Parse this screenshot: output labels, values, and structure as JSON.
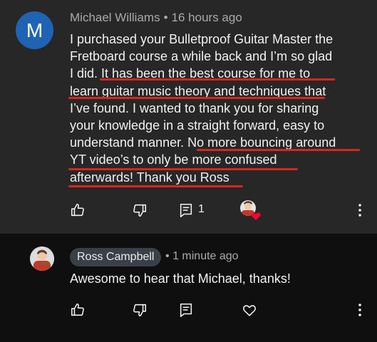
{
  "comment": {
    "avatar_letter": "M",
    "author": "Michael Williams",
    "separator": "•",
    "time": "16 hours ago",
    "body_lines": [
      "I purchased your Bulletproof Guitar Master the",
      "Fretboard course a while back and I’m so glad",
      "I did. It has been the best course for me to",
      "learn guitar music theory and techniques that",
      "I’ve found. I wanted to thank you for sharing",
      "your knowledge in a straight forward, easy to",
      "understand manner. No more bouncing around",
      "YT video’s to only be more confused",
      "afterwards! Thank you Ross"
    ],
    "reply_count": "1",
    "actions": {
      "like_icon": "thumbs-up-icon",
      "dislike_icon": "thumbs-down-icon",
      "reply_icon": "reply-comment-icon",
      "heart_icon": "creator-heart-icon",
      "more_icon": "more-vertical-icon"
    }
  },
  "reply": {
    "author": "Ross Campbell",
    "separator": "•",
    "time": "1 minute ago",
    "body": "Awesome to hear that Michael, thanks!",
    "actions": {
      "like_icon": "thumbs-up-icon",
      "dislike_icon": "thumbs-down-icon",
      "reply_icon": "reply-comment-icon",
      "heart_icon": "heart-outline-icon",
      "more_icon": "more-vertical-icon"
    }
  },
  "colors": {
    "comment_bg": "#272727",
    "reply_bg": "#0f0f0f",
    "avatar_blue": "#1e63b4",
    "underline_red": "#d7261e",
    "heart_red": "#ff0033",
    "text": "#f1f1f1",
    "meta_text": "#aaaaaa"
  }
}
